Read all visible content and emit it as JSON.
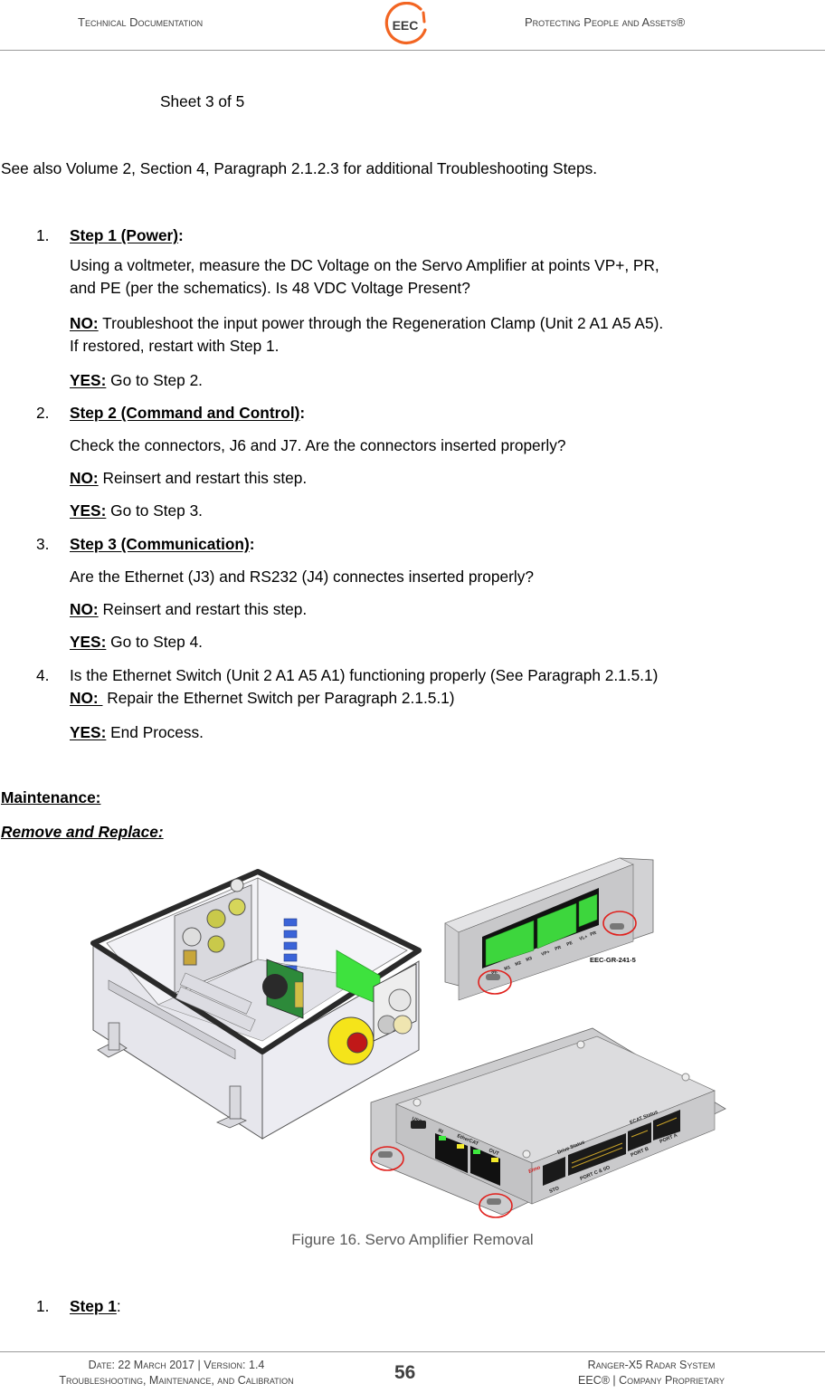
{
  "header": {
    "left": "Technical Documentation",
    "right": "Protecting People and Assets®",
    "logo_text": "EEC",
    "logo_ring_color": "#f26522",
    "logo_text_color": "#3c3c3c"
  },
  "sheet_label": "Sheet 3 of 5",
  "see_also": "See also Volume 2, Section 4, Paragraph 2.1.2.3 for additional Troubleshooting Steps.",
  "troubleshooting_steps": [
    {
      "number": "1.",
      "title": "Step 1 (Power)",
      "title_suffix": ":",
      "question_lines": [
        "Using a voltmeter, measure the DC Voltage on the Servo Amplifier at points VP+, PR,",
        "and PE (per the schematics).  Is 48 VDC Voltage Present?"
      ],
      "no_label": "NO:",
      "no_lines": [
        " Troubleshoot the input power through the Regeneration Clamp (Unit 2 A1 A5 A5).",
        "If restored, restart with Step 1."
      ],
      "yes_label": "YES:",
      "yes_text": " Go to Step 2."
    },
    {
      "number": "2.",
      "title": "Step 2 (Command and Control)",
      "title_suffix": ":",
      "question_lines": [
        "Check the connectors, J6 and J7.  Are the connectors inserted properly?"
      ],
      "no_label": "NO:",
      "no_lines": [
        " Reinsert and restart this step."
      ],
      "yes_label": "YES:",
      "yes_text": " Go to Step 3."
    },
    {
      "number": "3.",
      "title": "Step 3 (Communication)",
      "title_suffix": ":",
      "question_lines": [
        "Are the Ethernet (J3) and RS232 (J4) connectes inserted properly?"
      ],
      "no_label": "NO:",
      "no_lines": [
        " Reinsert and restart this step."
      ],
      "yes_label": "YES:",
      "yes_text": " Go to Step 4."
    },
    {
      "number": "4.",
      "question_lines": [
        "Is the Ethernet Switch (Unit 2 A1 A5 A1) functioning properly (See Paragraph 2.1.5.1)"
      ],
      "no_label": "NO: ",
      "no_lines": [
        " Repair the Ethernet Switch per Paragraph 2.1.5.1)"
      ],
      "yes_label": "YES:",
      "yes_text": " End Process."
    }
  ],
  "maintenance_heading": "Maintenance:",
  "remove_replace_heading": "Remove and Replace:",
  "figure": {
    "caption": "Figure 16. Servo Amplifier Removal",
    "top_amplifier": {
      "part_number": "EEC-GR-241-5",
      "terminal_labels": [
        "PE",
        "M1",
        "M2",
        "M3",
        "VP+",
        "PR",
        "PE",
        "VL+",
        "PR"
      ]
    },
    "bottom_amplifier": {
      "labels": [
        "USB",
        "IN",
        "EtherCAT",
        "OUT",
        "Drive Status",
        "STO",
        "PORT C & I/O",
        "ECAT Status",
        "PORT B",
        "PORT A",
        "Elmo"
      ]
    },
    "highlight_color": "#e0201c",
    "connector_green": "#3dd63d"
  },
  "removal_steps": [
    {
      "number": "1.",
      "title": "Step 1",
      "suffix": ":"
    }
  ],
  "footer": {
    "left_line1": "Date: 22 March 2017 | Version: 1.4",
    "left_line2": "Troubleshooting, Maintenance, and Calibration",
    "page_number": "56",
    "right_line1": "Ranger-X5 Radar System",
    "right_line2": "EEC® | Company Proprietary"
  }
}
